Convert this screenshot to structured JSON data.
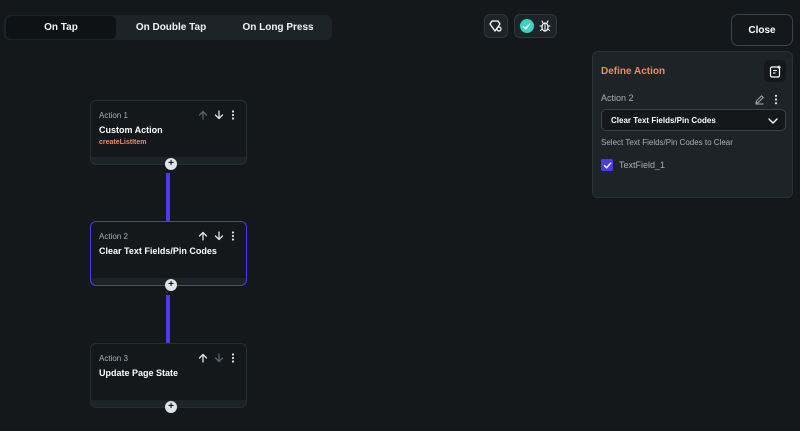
{
  "tabs": [
    {
      "label": "On Tap",
      "active": true
    },
    {
      "label": "On Double Tap",
      "active": false
    },
    {
      "label": "On Long Press",
      "active": false
    }
  ],
  "toolbar": {
    "close_label": "Close",
    "icons": [
      "diamond-settings-icon",
      "check-circle-icon",
      "bug-icon"
    ]
  },
  "actions": [
    {
      "num": "Action 1",
      "title": "Custom Action",
      "subtitle": "createListItem"
    },
    {
      "num": "Action 2",
      "title": "Clear Text Fields/Pin Codes"
    },
    {
      "num": "Action 3",
      "title": "Update Page State"
    }
  ],
  "panel": {
    "title": "Define Action",
    "action_label": "Action 2",
    "dropdown_value": "Clear Text Fields/Pin Codes",
    "hint": "Select Text Fields/Pin Codes to Clear",
    "checkbox_label": "TextField_1",
    "checked": true
  },
  "colors": {
    "background": "#14181b",
    "surface": "#1d2428",
    "primary": "#4b39ef",
    "accent": "#ee8b60",
    "check_green": "#39d2c0"
  }
}
